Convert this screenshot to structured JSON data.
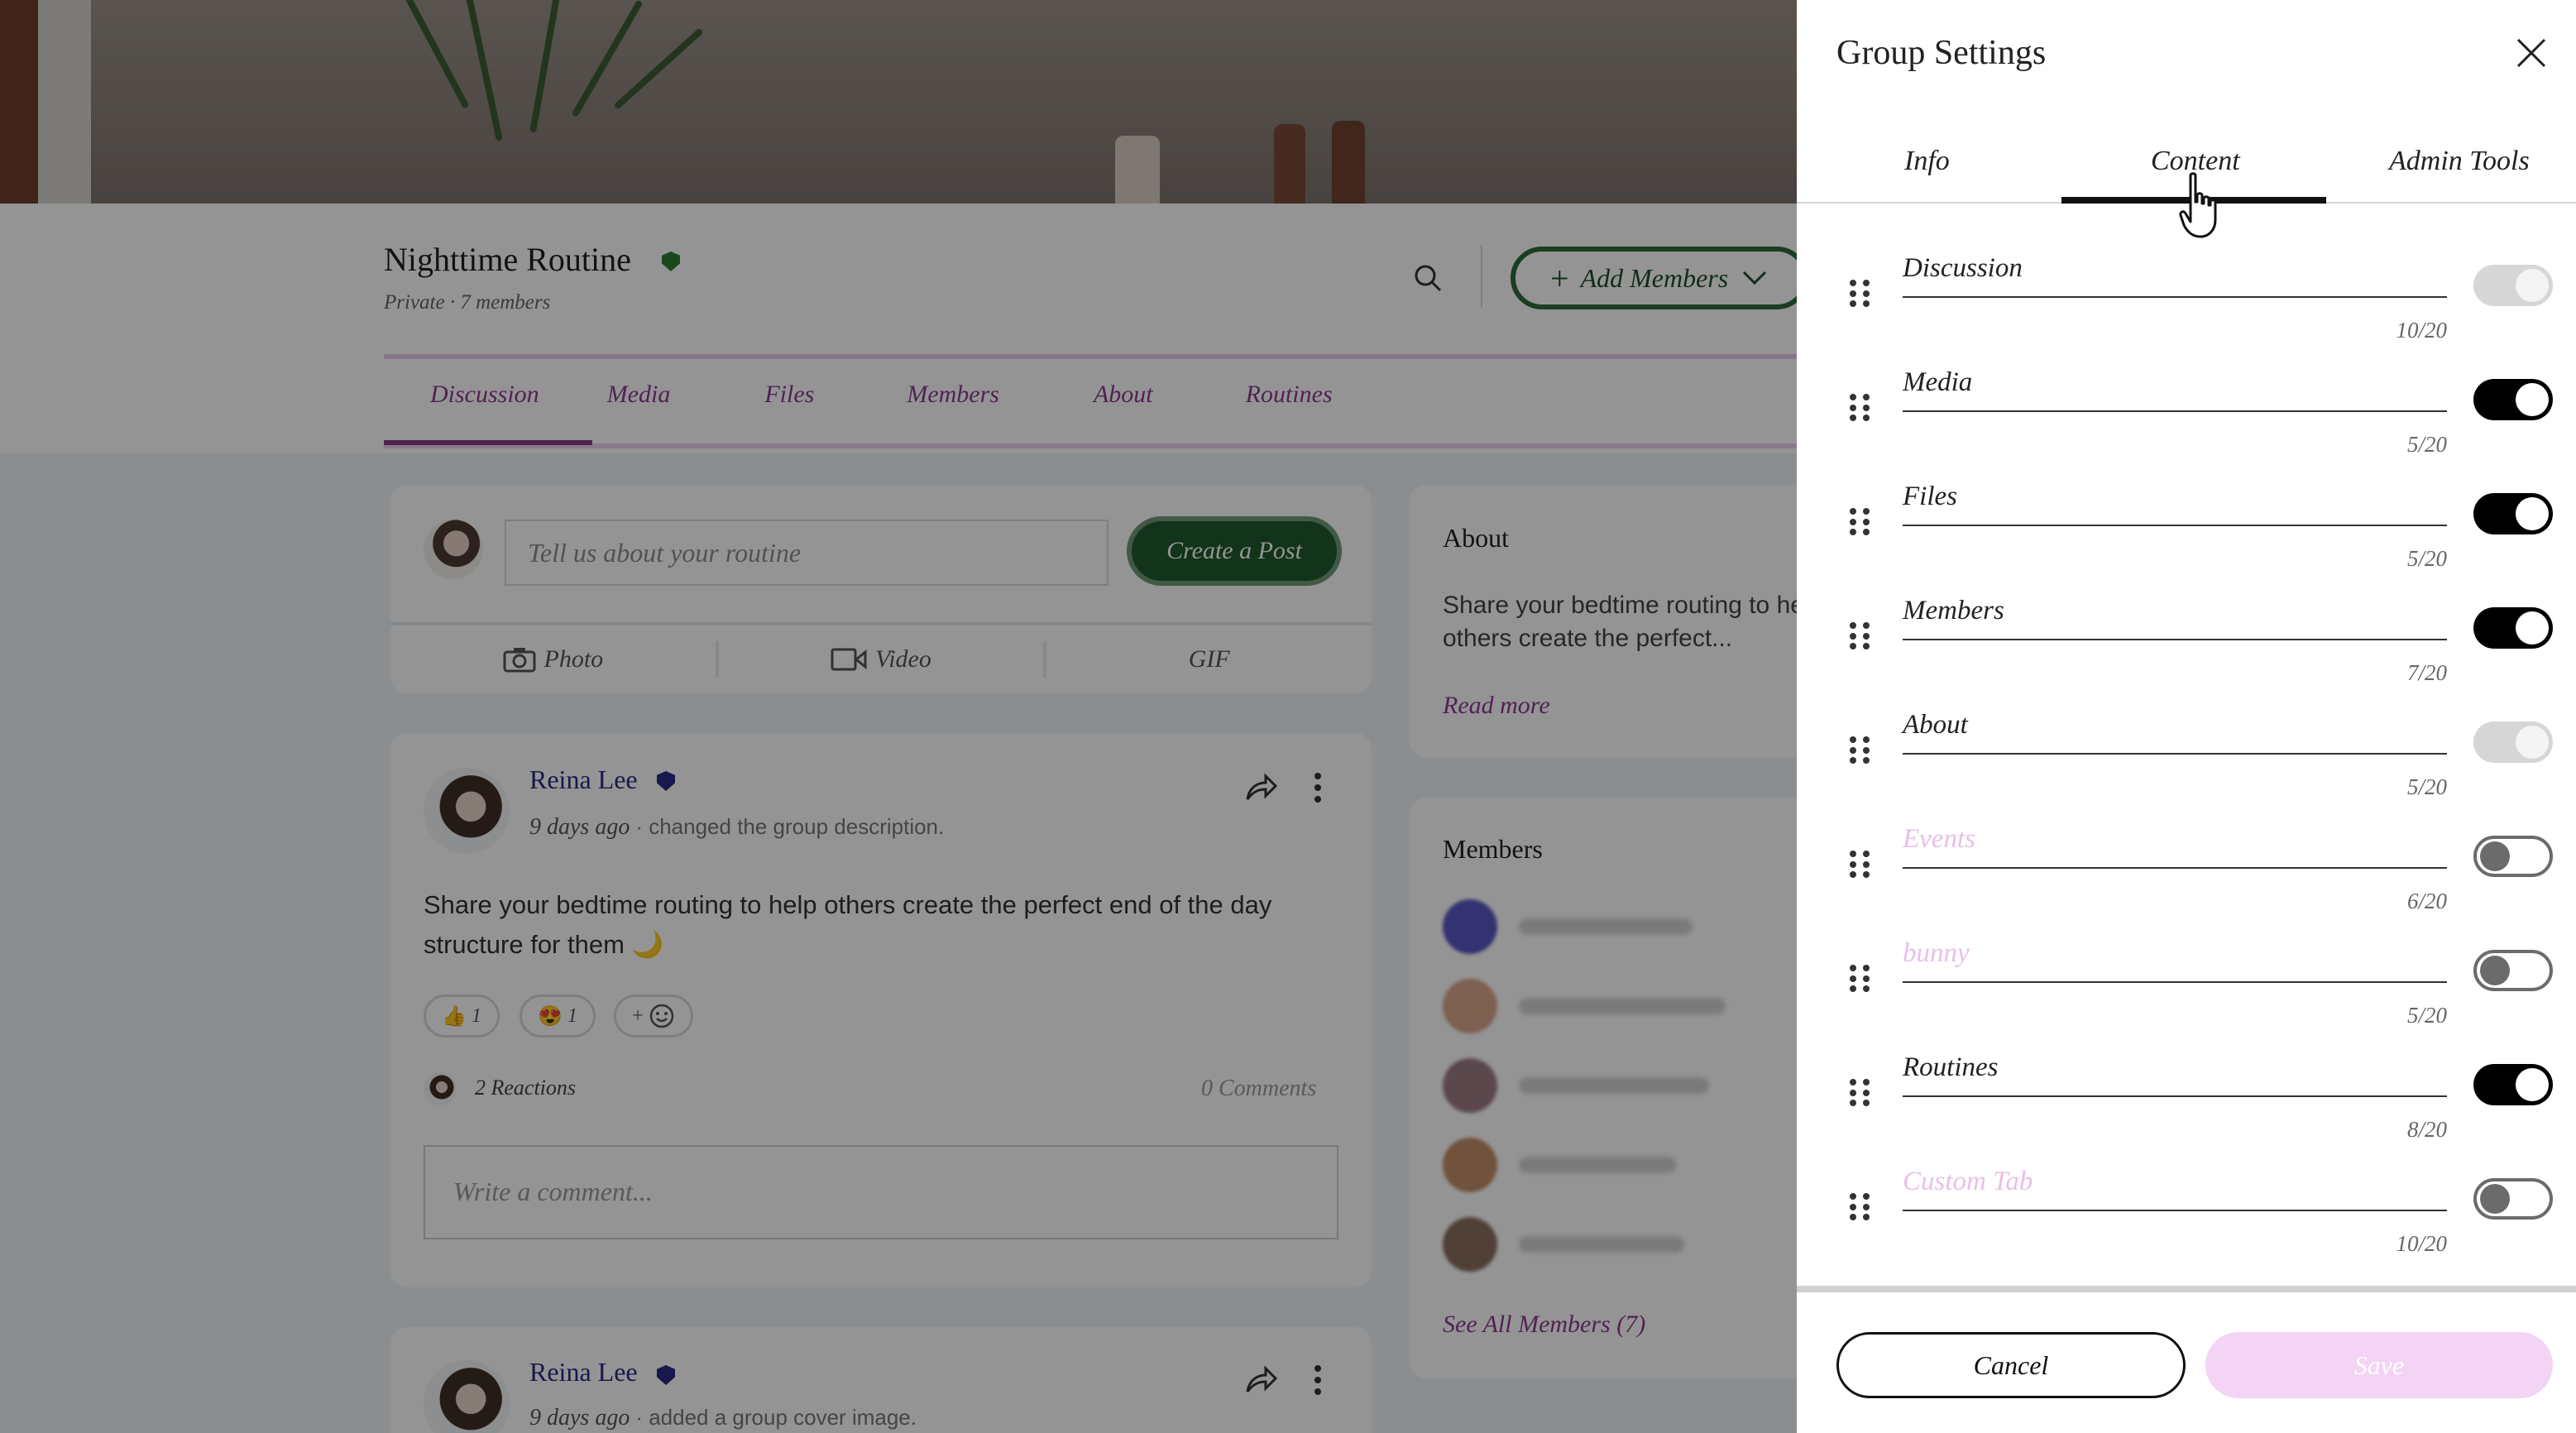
{
  "group": {
    "title": "Nighttime Routine",
    "subtitle": "Private · 7 members",
    "add_members_label": "Add Members",
    "tabs": [
      "Discussion",
      "Media",
      "Files",
      "Members",
      "About",
      "Routines"
    ]
  },
  "composer": {
    "placeholder": "Tell us about your routine",
    "create_post_label": "Create a Post",
    "photo_label": "Photo",
    "video_label": "Video",
    "gif_label": "GIF"
  },
  "posts": [
    {
      "author": "Reina Lee",
      "time": "9 days ago",
      "action": "· changed the group description.",
      "body": "Share your bedtime routing to help others create the perfect end of the day structure for them 🌙",
      "reactions": [
        {
          "emoji": "👍",
          "count": "1"
        },
        {
          "emoji": "😍",
          "count": "1"
        }
      ],
      "add_reaction": "+",
      "reactions_summary": "2 Reactions",
      "comments_summary": "0 Comments",
      "comment_placeholder": "Write a comment..."
    },
    {
      "author": "Reina Lee",
      "time": "9 days ago",
      "action": "· added a group cover image."
    }
  ],
  "sidebar": {
    "about_title": "About",
    "about_text": "Share your bedtime routing to help others create the perfect...",
    "read_more": "Read more",
    "members_title": "Members",
    "see_all": "See All Members (7)"
  },
  "settings": {
    "title": "Group Settings",
    "tabs": [
      "Info",
      "Content",
      "Admin Tools"
    ],
    "active_tab": "Content",
    "rows": [
      {
        "label": "Discussion",
        "count": "10/20",
        "state": "disabled-on"
      },
      {
        "label": "Media",
        "count": "5/20",
        "state": "on"
      },
      {
        "label": "Files",
        "count": "5/20",
        "state": "on"
      },
      {
        "label": "Members",
        "count": "7/20",
        "state": "on"
      },
      {
        "label": "About",
        "count": "5/20",
        "state": "disabled-on"
      },
      {
        "label": "Events",
        "count": "6/20",
        "state": "off"
      },
      {
        "label": "bunny",
        "count": "5/20",
        "state": "off"
      },
      {
        "label": "Routines",
        "count": "8/20",
        "state": "on"
      },
      {
        "label": "Custom Tab",
        "count": "10/20",
        "state": "off"
      }
    ],
    "cancel_label": "Cancel",
    "save_label": "Save"
  },
  "colors": {
    "accent_purple": "#8a3b90",
    "brand_green": "#1f5a2d",
    "disabled_label": "#e8bfe9",
    "save_disabled_bg": "#f3d4f4"
  }
}
